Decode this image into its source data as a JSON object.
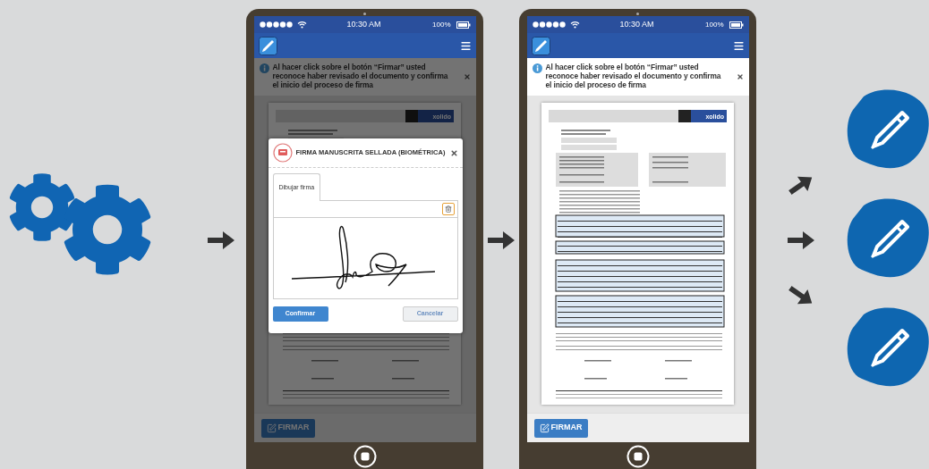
{
  "phones": [
    {
      "dimmed": true,
      "status": {
        "time": "10:30 AM",
        "battery": "100%"
      },
      "notice": "Al hacer click sobre el botón “Firmar” usted reconoce haber revisado el documento y confirma el inicio del proceso de firma",
      "document": {
        "logo": "xolido"
      },
      "sign_button": "FIRMAR",
      "dialog": {
        "title": "FIRMA MANUSCRITA SELLADA (BIOMÉTRICA)",
        "tabs": [
          {
            "label": "Dibujar firma",
            "selected": true
          }
        ],
        "confirm": "Confirmar",
        "cancel": "Cancelar"
      }
    },
    {
      "dimmed": false,
      "status": {
        "time": "10:30 AM",
        "battery": "100%"
      },
      "notice": "Al hacer click sobre el botón “Firmar” usted reconoce haber revisado el documento y confirma el inicio del proceso de firma",
      "document": {
        "logo": "xolido"
      },
      "sign_button": "FIRMAR"
    }
  ]
}
